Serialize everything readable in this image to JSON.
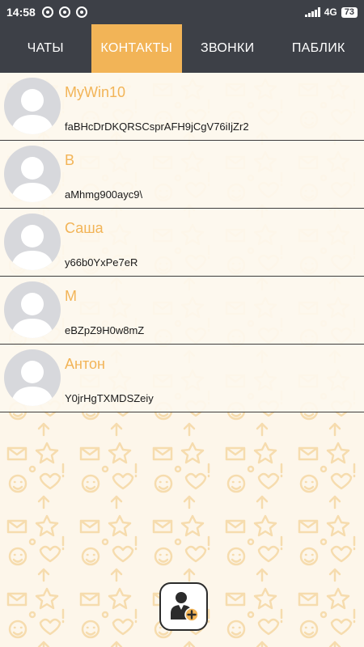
{
  "status_bar": {
    "time": "14:58",
    "network": "4G",
    "battery": "73",
    "icons": [
      "notification-icon",
      "chrome-icon",
      "notification-icon",
      "signal-icon",
      "battery-icon"
    ]
  },
  "tabs": [
    {
      "label": "ЧАТЫ",
      "active": false
    },
    {
      "label": "КОНТАКТЫ",
      "active": true
    },
    {
      "label": "ЗВОНКИ",
      "active": false
    },
    {
      "label": "ПАБЛИК",
      "active": false
    }
  ],
  "contacts": [
    {
      "name": "MyWin10",
      "id": "faBHcDrDKQRSCsprAFH9jCgV76iIjZr2"
    },
    {
      "name": "B",
      "id": "aMhmg900ayc9\\"
    },
    {
      "name": "Саша",
      "id": "y66b0YxPe7eR"
    },
    {
      "name": "M",
      "id": "eBZpZ9H0w8mZ"
    },
    {
      "name": "Антон",
      "id": "Y0jrHgTXMDSZeiy"
    }
  ],
  "add_contact_button": {
    "icon": "add-contact-icon"
  },
  "colors": {
    "accent": "#f2b457",
    "topbar": "#3d4047",
    "background": "#fdf6ea",
    "avatar_bg": "#d7d8dc"
  }
}
